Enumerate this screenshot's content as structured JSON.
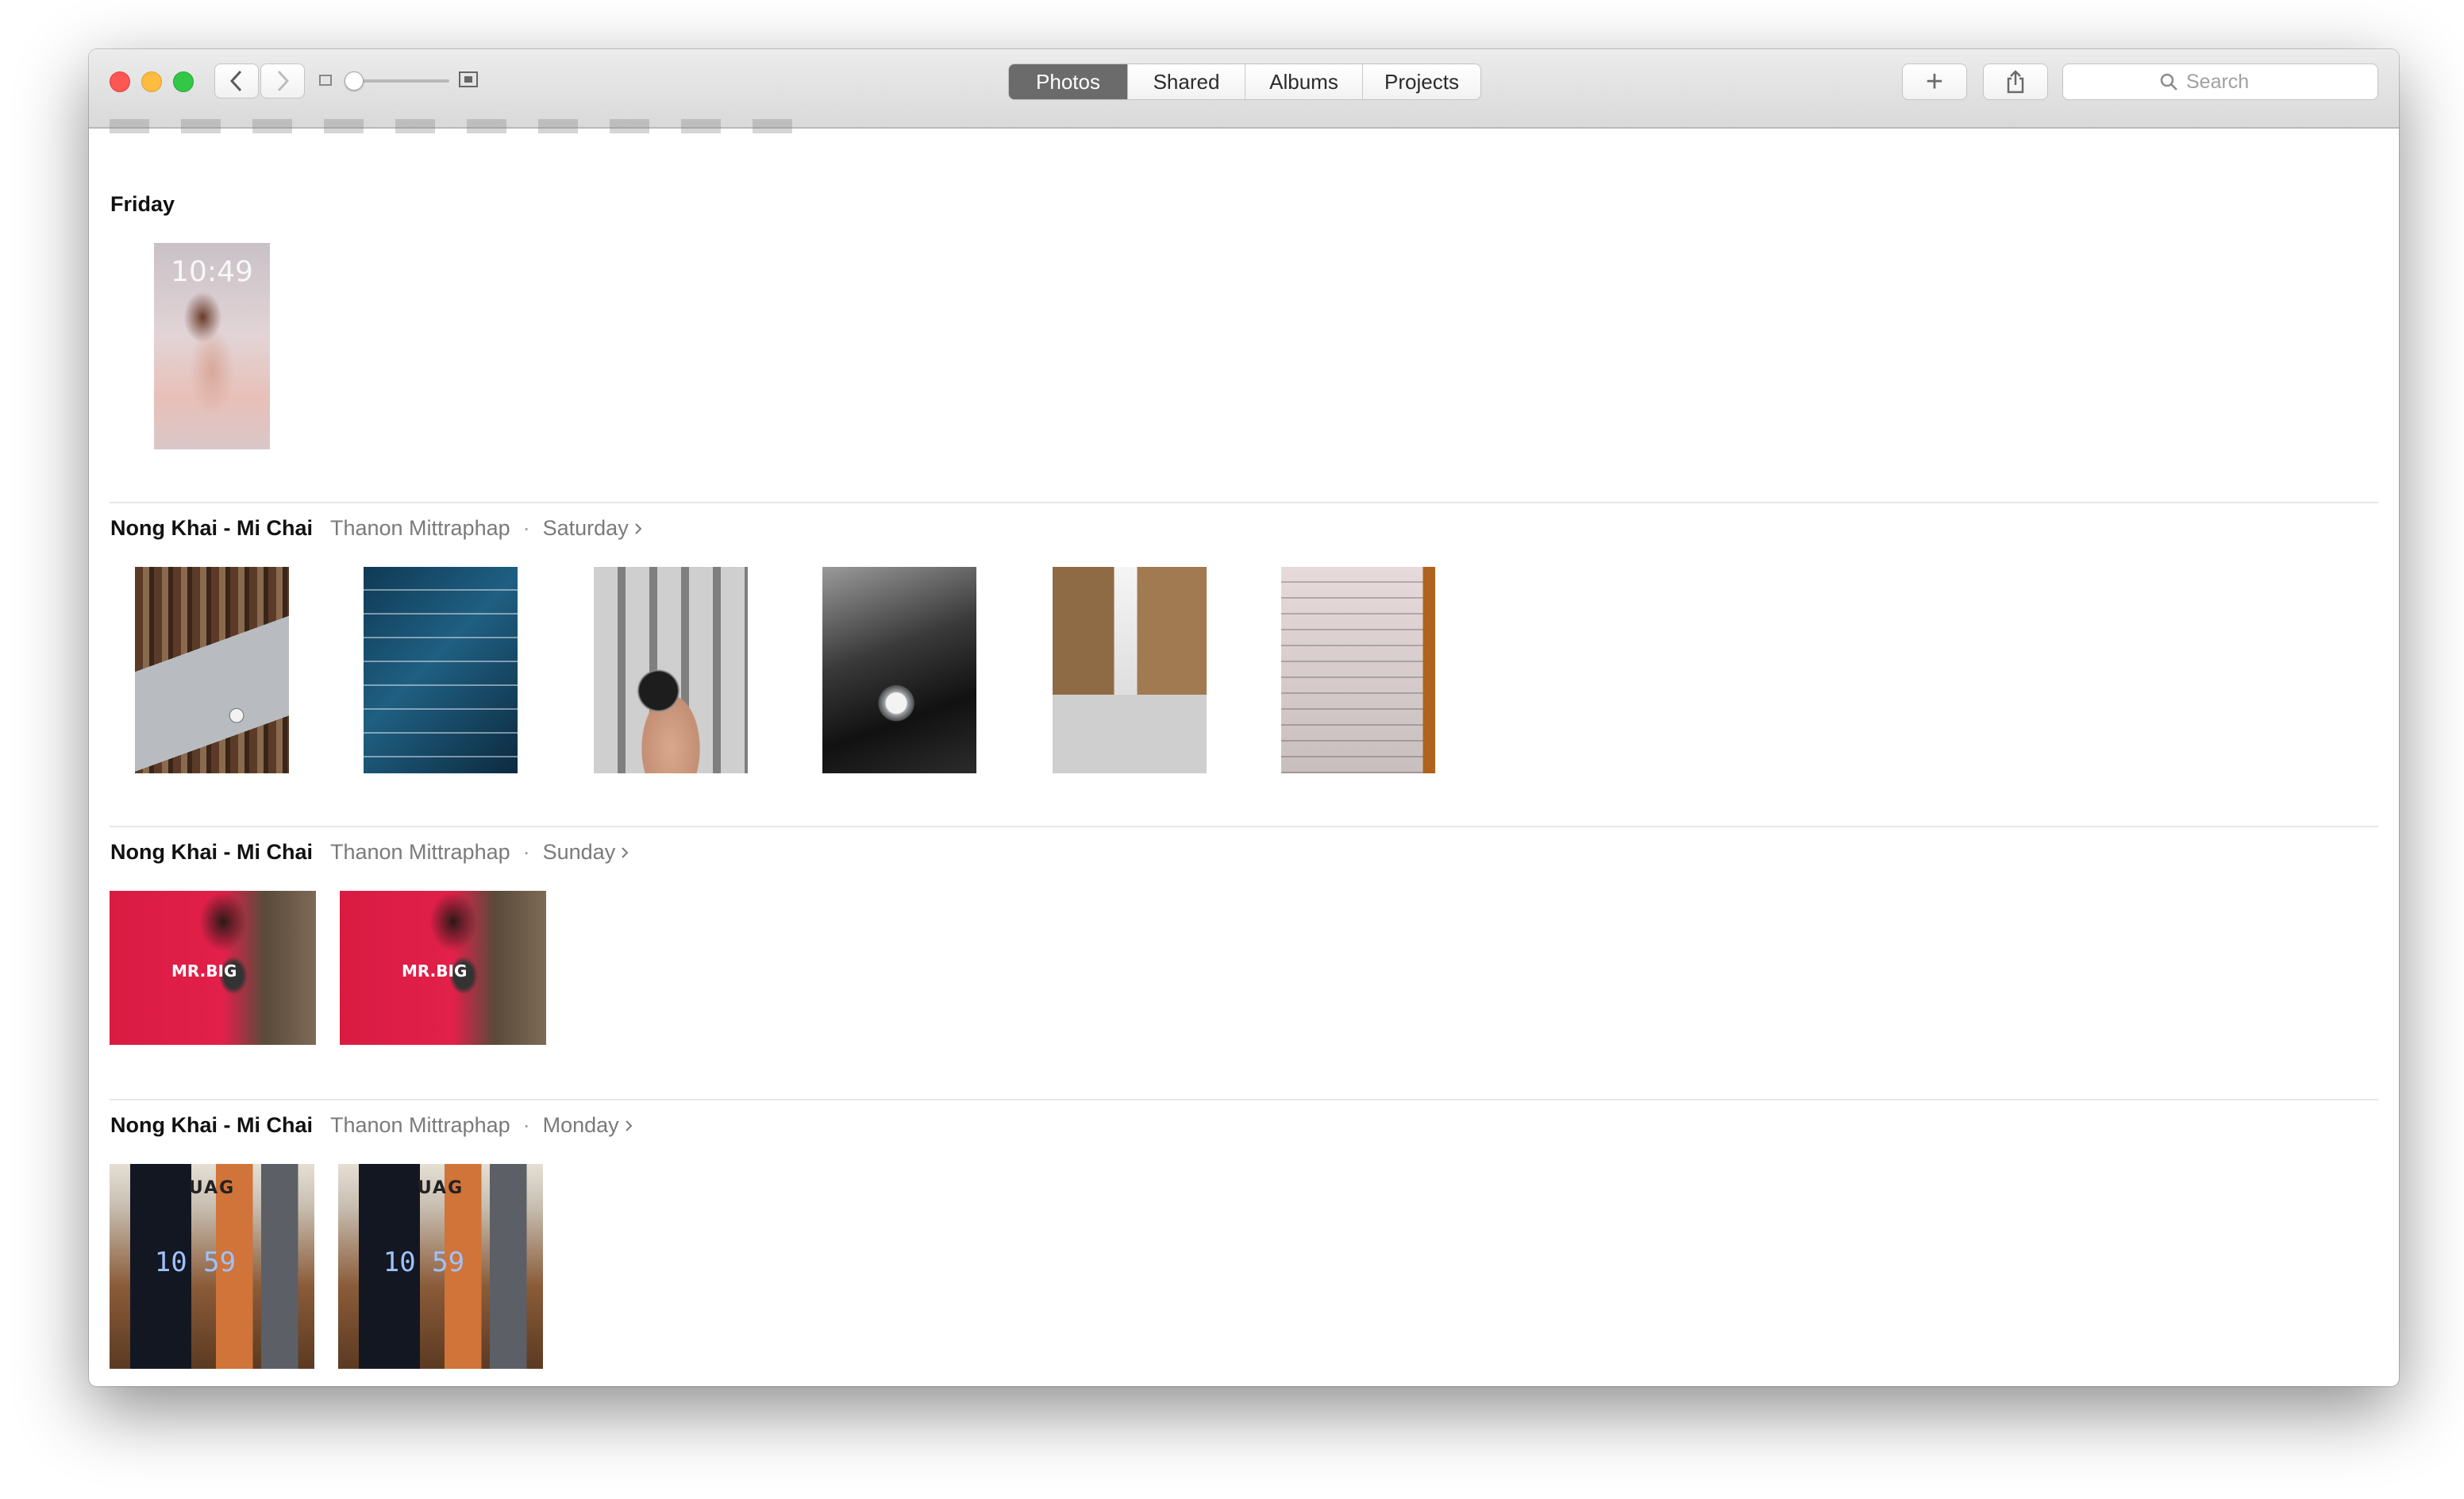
{
  "toolbar": {
    "tabs": [
      "Photos",
      "Shared",
      "Albums",
      "Projects"
    ],
    "active_tab": "Photos",
    "add_label": "+",
    "search_placeholder": "Search"
  },
  "sections": [
    {
      "title": "Friday",
      "location": "",
      "day": "",
      "photos": [
        {
          "alt": "Lock screen photo",
          "clock": "10:49"
        }
      ]
    },
    {
      "title": "Nong Khai - Mi Chai",
      "location": "Thanon Mittraphap",
      "day": "Saturday",
      "photos": [
        {
          "alt": "Bookshelf with phone"
        },
        {
          "alt": "Sensor specifications card"
        },
        {
          "alt": "Finger holding sensor cap"
        },
        {
          "alt": "Tire valve sensor"
        },
        {
          "alt": "Shop interior"
        },
        {
          "alt": "Receipt"
        }
      ]
    },
    {
      "title": "Nong Khai - Mi Chai",
      "location": "Thanon Mittraphap",
      "day": "Sunday",
      "photos": [
        {
          "alt": "Person in red shirt with phone",
          "shirt": "MR.BIG"
        },
        {
          "alt": "Person in red shirt with phone",
          "shirt": "MR.BIG"
        }
      ]
    },
    {
      "title": "Nong Khai - Mi Chai",
      "location": "Thanon Mittraphap",
      "day": "Monday",
      "photos": [
        {
          "alt": "UAG phone cases",
          "brand": "UAG",
          "time": "10 59"
        },
        {
          "alt": "UAG phone cases",
          "brand": "UAG",
          "time": "10 59"
        }
      ]
    }
  ],
  "colors": {
    "active_tab_bg": "#6b6b6b",
    "close": "#fc5753",
    "minimize": "#fdbc40",
    "zoom": "#33c748"
  }
}
